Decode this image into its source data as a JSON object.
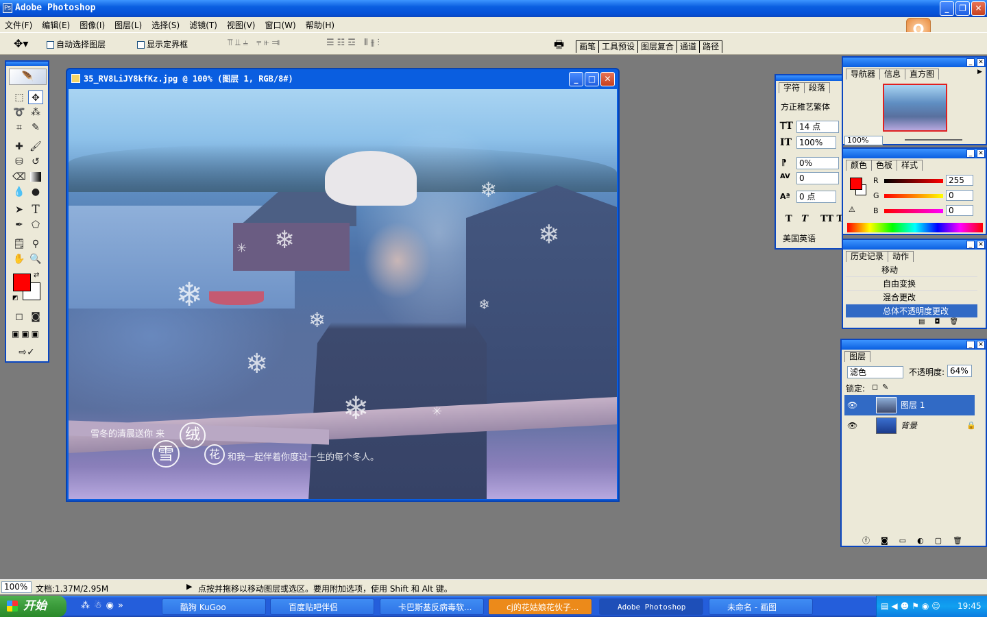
{
  "app": {
    "title": "Adobe Photoshop"
  },
  "menu": [
    "文件(F)",
    "编辑(E)",
    "图像(I)",
    "图层(L)",
    "选择(S)",
    "滤镜(T)",
    "视图(V)",
    "窗口(W)",
    "帮助(H)"
  ],
  "options": {
    "auto_select": "自动选择图层",
    "show_bounds": "显示定界框"
  },
  "well_tabs": [
    "画笔",
    "工具预设",
    "图层复合",
    "通道",
    "路径"
  ],
  "document": {
    "title": "35_RV8LiJY8kfKz.jpg @ 100% (图层 1, RGB/8#)",
    "overlay_lines": [
      "雪冬的清晨送你  来",
      "和我一起伴着你度过一生的每个冬人。"
    ],
    "seal_chars": [
      "雪",
      "绒",
      "花"
    ]
  },
  "character": {
    "tabs": [
      "字符",
      "段落"
    ],
    "font": "方正稚艺繁体",
    "size": "14 点",
    "scale": "100%",
    "tracking": "0%",
    "kerning": "0",
    "baseline": "0 点",
    "language": "美国英语",
    "styles": [
      "T",
      "T",
      "TT",
      "T"
    ]
  },
  "navigator": {
    "tabs": [
      "导航器",
      "信息",
      "直方图"
    ],
    "zoom": "100%"
  },
  "color": {
    "tabs": [
      "颜色",
      "色板",
      "样式"
    ],
    "r": "255",
    "g": "0",
    "b": "0",
    "labels": [
      "R",
      "G",
      "B"
    ],
    "fg": "#ff0000"
  },
  "history": {
    "tabs": [
      "历史记录",
      "动作"
    ],
    "items": [
      "移动",
      "自由变换",
      "混合更改",
      "总体不透明度更改"
    ],
    "selected": 3
  },
  "layers": {
    "tab": "图层",
    "blend": "滤色",
    "opacity_label": "不透明度:",
    "opacity": "64%",
    "lock_label": "锁定:",
    "items": [
      "图层 1",
      "背景"
    ],
    "selected": 0
  },
  "status": {
    "zoom": "100%",
    "doc": "文档:1.37M/2.95M",
    "hint": "点按并拖移以移动图层或选区。要用附加选项，使用 Shift 和 Alt 键。"
  },
  "taskbar": {
    "start": "开始",
    "items": [
      "酷狗 KuGoo",
      "百度贴吧伴侣",
      "卡巴斯基反病毒软...",
      "cj的花姑娘花伙子...",
      "Adobe Photoshop",
      "未命名 - 画图"
    ],
    "clock": "19:45"
  }
}
